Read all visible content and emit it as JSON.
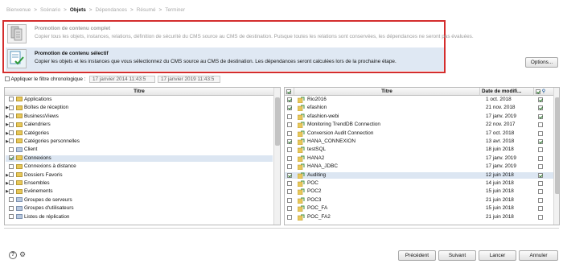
{
  "breadcrumb": {
    "steps": [
      "Bienvenue",
      "Scénario",
      "Objets",
      "Dépendances",
      "Résumé",
      "Terminer"
    ],
    "separator": ">"
  },
  "options": [
    {
      "title": "Promotion de contenu complet",
      "desc": "Copier tous les objets, instances, relations, définition de sécurité du CMS source au CMS de destination. Puisque toutes les relations sont conservées, les dépendances ne seront pas évaluées.",
      "selected": false,
      "icon": "full-promotion-icon"
    },
    {
      "title": "Promotion de contenu sélectif",
      "desc": "Copier les objets et les instances que vous sélectionnez du CMS source au CMS de destination. Les dépendances seront calculées lors de la prochaine étape.",
      "selected": true,
      "icon": "selective-promotion-icon"
    }
  ],
  "options_button": "Options...",
  "filter": {
    "label": "Appliquer le filtre chronologique :",
    "from": "17 janvier 2014 11:43:5",
    "to": "17 janvier 2019 11:43:5",
    "enabled": false
  },
  "left": {
    "header": "Titre",
    "items": [
      {
        "label": "Applications",
        "expand": false,
        "checked": false
      },
      {
        "label": "Boîtes de réception",
        "expand": true,
        "checked": false
      },
      {
        "label": "BusinessViews",
        "expand": true,
        "checked": false
      },
      {
        "label": "Calendriers",
        "expand": true,
        "checked": false
      },
      {
        "label": "Catégories",
        "expand": true,
        "checked": false
      },
      {
        "label": "Catégories personnelles",
        "expand": true,
        "checked": false
      },
      {
        "label": "Client",
        "expand": false,
        "checked": false
      },
      {
        "label": "Connexions",
        "expand": false,
        "checked": true,
        "highlight": true
      },
      {
        "label": "Connexions à distance",
        "expand": false,
        "checked": false
      },
      {
        "label": "Dossiers Favoris",
        "expand": true,
        "checked": false
      },
      {
        "label": "Ensembles",
        "expand": true,
        "checked": false
      },
      {
        "label": "Evénements",
        "expand": true,
        "checked": false
      },
      {
        "label": "Groupes de serveurs",
        "expand": false,
        "checked": false
      },
      {
        "label": "Groupes d'utilisateurs",
        "expand": false,
        "checked": false
      },
      {
        "label": "Listes de réplication",
        "expand": false,
        "checked": false
      }
    ]
  },
  "right": {
    "header_title": "Titre",
    "header_date": "Date de modifi...",
    "rows": [
      {
        "title": "Rio2016",
        "date": "1 oct. 2018",
        "sel": true,
        "dep": true
      },
      {
        "title": "efashion",
        "date": "21 nov. 2018",
        "sel": true,
        "dep": true
      },
      {
        "title": "efashion-webi",
        "date": "17 janv. 2019",
        "sel": false,
        "dep": true
      },
      {
        "title": "Monitoring TrendDB Connection",
        "date": "22 nov. 2017",
        "sel": false,
        "dep": false
      },
      {
        "title": "Conversion Audit Connection",
        "date": "17 oct. 2018",
        "sel": false,
        "dep": false
      },
      {
        "title": "HANA_CONNEXION",
        "date": "13 avr. 2018",
        "sel": true,
        "dep": true
      },
      {
        "title": "testSQL",
        "date": "18 juin 2018",
        "sel": false,
        "dep": false
      },
      {
        "title": "HANA2",
        "date": "17 janv. 2019",
        "sel": false,
        "dep": false
      },
      {
        "title": "HANA_JDBC",
        "date": "17 janv. 2019",
        "sel": false,
        "dep": false
      },
      {
        "title": "Auditing",
        "date": "12 juin 2018",
        "sel": true,
        "dep": true,
        "highlight": true
      },
      {
        "title": "POC",
        "date": "14 juin 2018",
        "sel": false,
        "dep": false
      },
      {
        "title": "POC2",
        "date": "15 juin 2018",
        "sel": false,
        "dep": false
      },
      {
        "title": "POC3",
        "date": "21 juin 2018",
        "sel": false,
        "dep": false
      },
      {
        "title": "POC_FA",
        "date": "15 juin 2018",
        "sel": false,
        "dep": false
      },
      {
        "title": "POC_FA2",
        "date": "21 juin 2018",
        "sel": false,
        "dep": false
      }
    ]
  },
  "footer": {
    "help": "?",
    "prev": "Précédent",
    "next": "Suivant",
    "cancel": "Lancer",
    "close": "Annuler"
  }
}
